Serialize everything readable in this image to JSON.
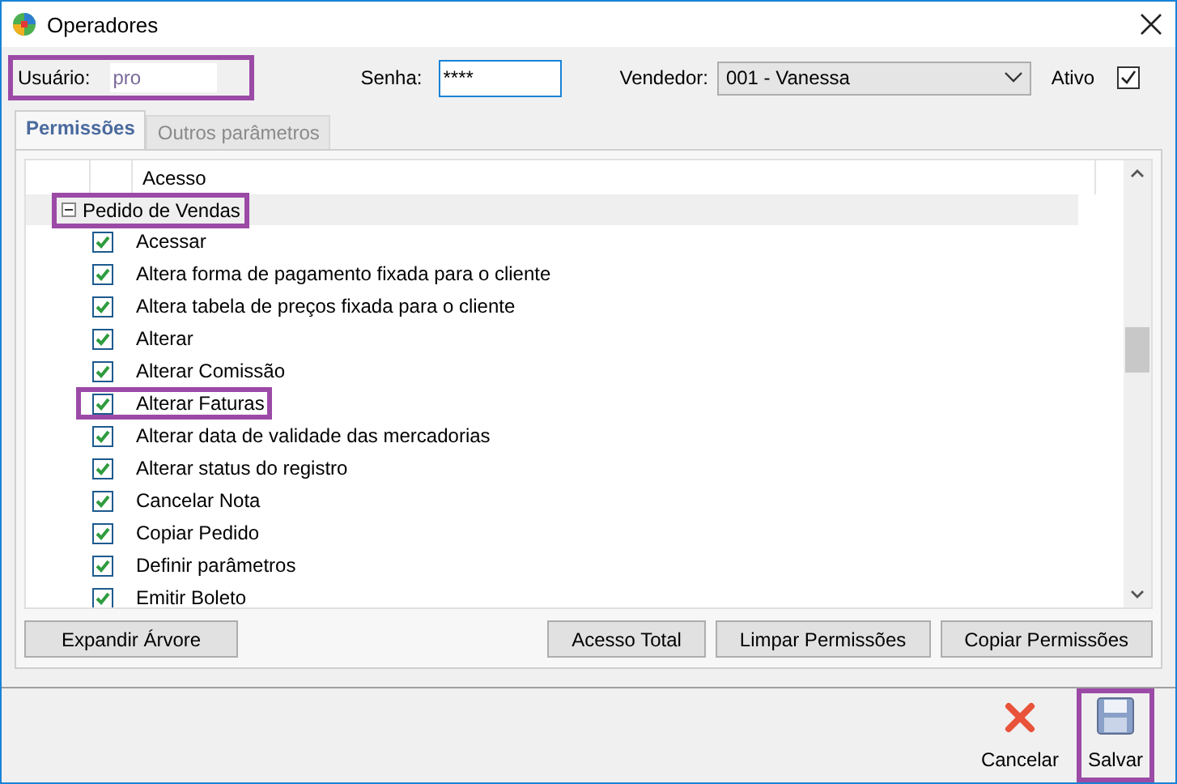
{
  "window": {
    "title": "Operadores"
  },
  "form": {
    "user_label": "Usuário:",
    "user_value": "pro",
    "user_highlighted": true,
    "password_label": "Senha:",
    "password_value": "****",
    "seller_label": "Vendedor:",
    "seller_value": "001 - Vanessa",
    "active_label": "Ativo",
    "active_checked": true
  },
  "tabs": [
    {
      "label": "Permissões",
      "selected": true
    },
    {
      "label": "Outros parâmetros",
      "selected": false
    }
  ],
  "tree": {
    "column": "Acesso",
    "groups": [
      {
        "label": "Pedido de Vendas",
        "expanded": true,
        "highlighted": true,
        "children": [
          {
            "label": "Acessar",
            "checked": true,
            "highlighted": false
          },
          {
            "label": "Altera forma de pagamento fixada para o cliente",
            "checked": true,
            "highlighted": false
          },
          {
            "label": "Altera tabela de preços fixada para o cliente",
            "checked": true,
            "highlighted": false
          },
          {
            "label": "Alterar",
            "checked": true,
            "highlighted": false
          },
          {
            "label": "Alterar Comissão",
            "checked": true,
            "highlighted": false
          },
          {
            "label": "Alterar Faturas",
            "checked": true,
            "highlighted": true
          },
          {
            "label": "Alterar data de validade das mercadorias",
            "checked": true,
            "highlighted": false
          },
          {
            "label": "Alterar status do registro",
            "checked": true,
            "highlighted": false
          },
          {
            "label": "Cancelar Nota",
            "checked": true,
            "highlighted": false
          },
          {
            "label": "Copiar Pedido",
            "checked": true,
            "highlighted": false
          },
          {
            "label": "Definir parâmetros",
            "checked": true,
            "highlighted": false
          },
          {
            "label": "Emitir Boleto",
            "checked": true,
            "highlighted": false
          }
        ]
      }
    ]
  },
  "panel_buttons": {
    "left": [
      "Expandir Árvore"
    ],
    "right": [
      "Acesso Total",
      "Limpar Permissões",
      "Copiar Permissões"
    ]
  },
  "actions": [
    {
      "kind": "cancel",
      "label": "Cancelar",
      "highlighted": false
    },
    {
      "kind": "save",
      "label": "Salvar",
      "highlighted": true
    }
  ]
}
